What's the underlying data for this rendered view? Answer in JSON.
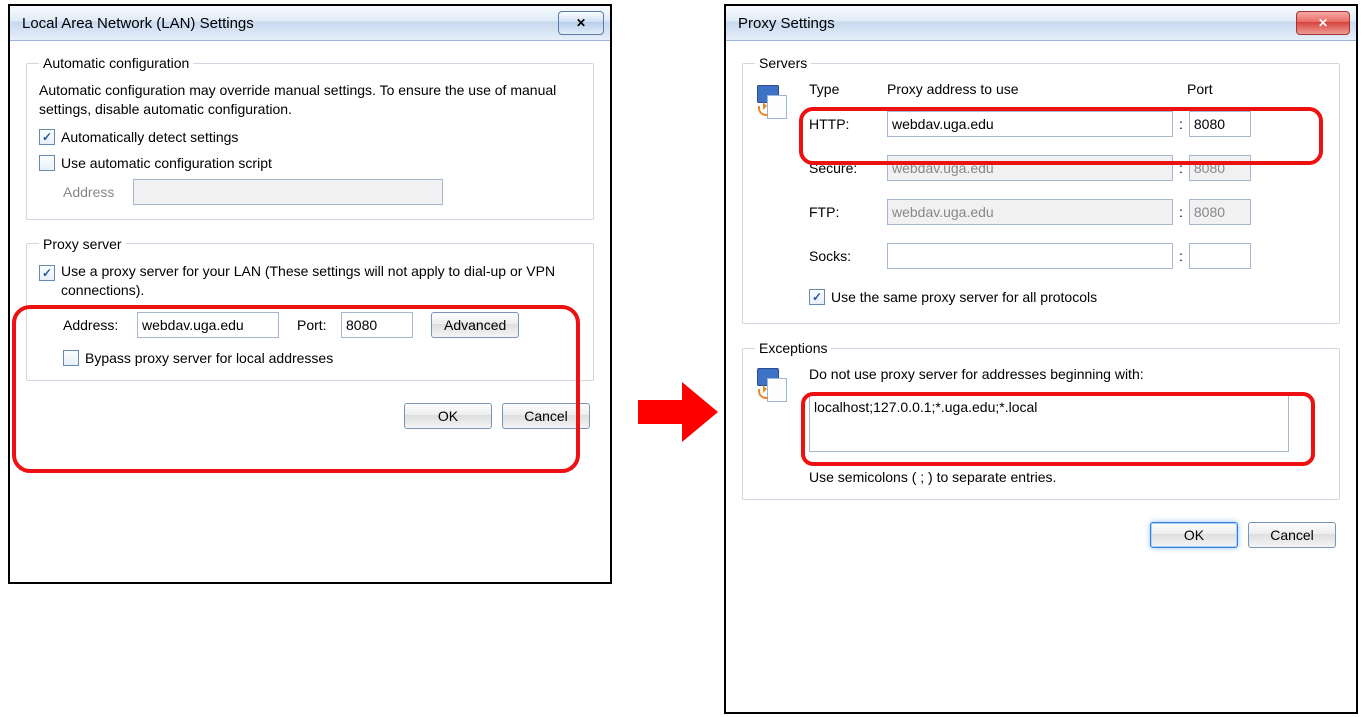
{
  "lan": {
    "title": "Local Area Network (LAN) Settings",
    "auto": {
      "legend": "Automatic configuration",
      "desc": "Automatic configuration may override manual settings.  To ensure the use of manual settings, disable automatic configuration.",
      "auto_detect_label": "Automatically detect settings",
      "use_script_label": "Use automatic configuration script",
      "address_label": "Address",
      "address_value": ""
    },
    "proxy": {
      "legend": "Proxy server",
      "use_proxy_label": "Use a proxy server for your LAN (These settings will not apply to dial-up or VPN connections).",
      "address_label": "Address:",
      "address_value": "webdav.uga.edu",
      "port_label": "Port:",
      "port_value": "8080",
      "advanced_label": "Advanced",
      "bypass_label": "Bypass proxy server for local addresses"
    },
    "ok": "OK",
    "cancel": "Cancel"
  },
  "adv": {
    "title": "Proxy Settings",
    "servers": {
      "legend": "Servers",
      "type_hdr": "Type",
      "addr_hdr": "Proxy address to use",
      "port_hdr": "Port",
      "rows": {
        "http": {
          "label": "HTTP:",
          "addr": "webdav.uga.edu",
          "port": "8080",
          "enabled": true
        },
        "secure": {
          "label": "Secure:",
          "addr": "webdav.uga.edu",
          "port": "8080",
          "enabled": false
        },
        "ftp": {
          "label": "FTP:",
          "addr": "webdav.uga.edu",
          "port": "8080",
          "enabled": false
        },
        "socks": {
          "label": "Socks:",
          "addr": "",
          "port": "",
          "enabled": true
        }
      },
      "same_label": "Use the same proxy server for all protocols"
    },
    "exceptions": {
      "legend": "Exceptions",
      "desc": "Do not use proxy server for addresses beginning with:",
      "value": "localhost;127.0.0.1;*.uga.edu;*.local ",
      "hint": "Use semicolons ( ; ) to separate entries."
    },
    "ok": "OK",
    "cancel": "Cancel"
  }
}
